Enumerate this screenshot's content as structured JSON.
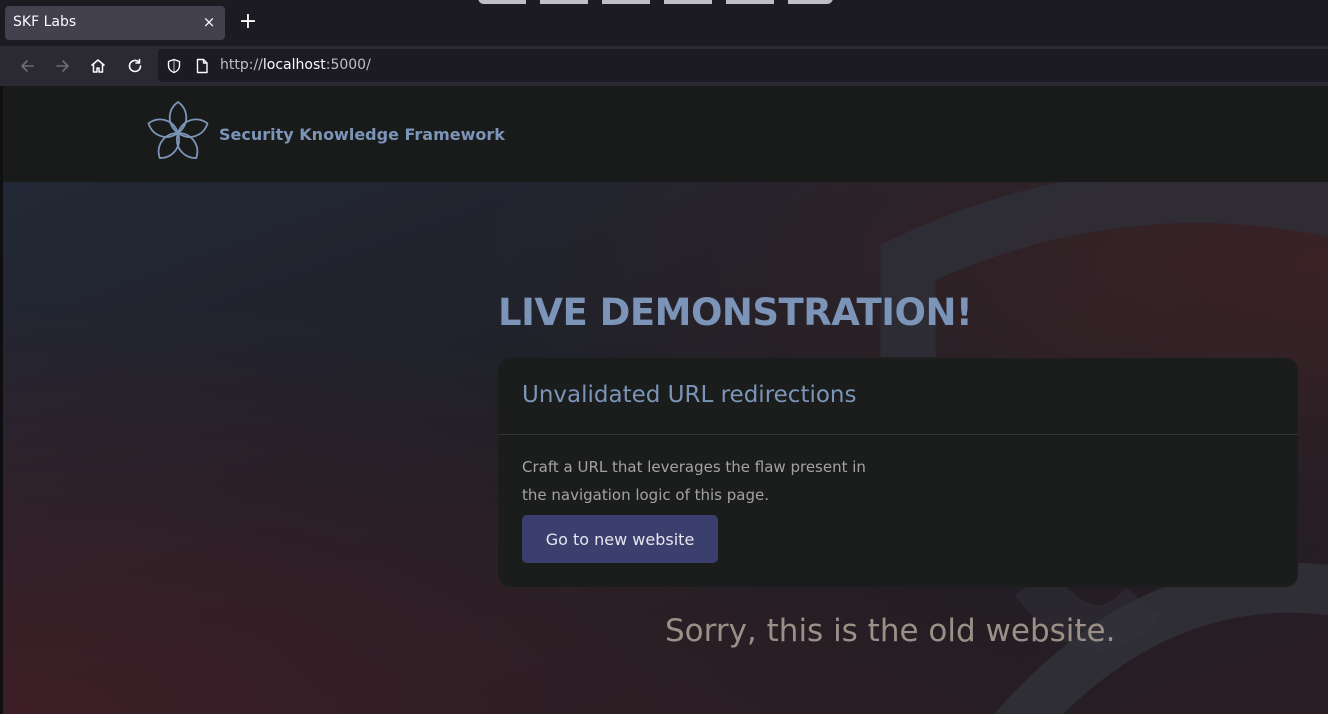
{
  "browser": {
    "tab_title": "SKF Labs",
    "tab_close": "×",
    "new_tab": "+",
    "url_prefix": "http://",
    "url_host": "localhost",
    "url_suffix": ":5000/"
  },
  "header": {
    "brand": "Security Knowledge Framework",
    "logo_icon": "skf-flower-logo-icon"
  },
  "main": {
    "heading": "LIVE DEMONSTRATION!",
    "card": {
      "title": "Unvalidated URL redirections",
      "description_line1": "Craft a URL that leverages the flaw present in",
      "description_line2": "the navigation logic of this page.",
      "button_label": "Go to new website"
    },
    "message": "Sorry, this is the old website."
  },
  "colors": {
    "accent": "#7b94b8",
    "button": "#3b3f6e",
    "card_bg": "#1b1c1c",
    "header_bg": "#191a1a"
  }
}
